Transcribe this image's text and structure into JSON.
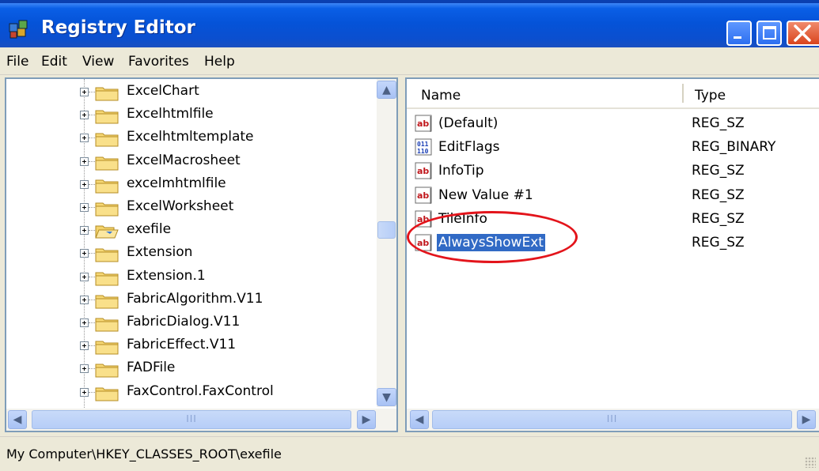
{
  "window": {
    "title": "Registry Editor"
  },
  "menu": [
    "File",
    "Edit",
    "View",
    "Favorites",
    "Help"
  ],
  "tree": {
    "items": [
      {
        "label": "ExcelChart",
        "open": false
      },
      {
        "label": "Excelhtmlfile",
        "open": false
      },
      {
        "label": "Excelhtmltemplate",
        "open": false
      },
      {
        "label": "ExcelMacrosheet",
        "open": false
      },
      {
        "label": "excelmhtmlfile",
        "open": false
      },
      {
        "label": "ExcelWorksheet",
        "open": false
      },
      {
        "label": "exefile",
        "open": true
      },
      {
        "label": "Extension",
        "open": false
      },
      {
        "label": "Extension.1",
        "open": false
      },
      {
        "label": "FabricAlgorithm.V11",
        "open": false
      },
      {
        "label": "FabricDialog.V11",
        "open": false
      },
      {
        "label": "FabricEffect.V11",
        "open": false
      },
      {
        "label": "FADFile",
        "open": false
      },
      {
        "label": "FaxControl.FaxControl",
        "open": false
      }
    ],
    "hscroll_grip": "III"
  },
  "values": {
    "columns": {
      "name": "Name",
      "type": "Type"
    },
    "rows": [
      {
        "name": "(Default)",
        "type": "REG_SZ",
        "icon": "string-value-icon",
        "selected": false
      },
      {
        "name": "EditFlags",
        "type": "REG_BINARY",
        "icon": "binary-value-icon",
        "selected": false
      },
      {
        "name": "InfoTip",
        "type": "REG_SZ",
        "icon": "string-value-icon",
        "selected": false
      },
      {
        "name": "New Value #1",
        "type": "REG_SZ",
        "icon": "string-value-icon",
        "selected": false
      },
      {
        "name": "TileInfo",
        "type": "REG_SZ",
        "icon": "string-value-icon",
        "selected": false
      },
      {
        "name": "AlwaysShowExt",
        "type": "REG_SZ",
        "icon": "string-value-icon",
        "selected": true
      }
    ],
    "hscroll_grip": "III"
  },
  "status": {
    "path": "My Computer\\HKEY_CLASSES_ROOT\\exefile"
  },
  "colors": {
    "titlebar": "#0553d8",
    "selection": "#316ac5",
    "annotation": "#e3141b"
  }
}
